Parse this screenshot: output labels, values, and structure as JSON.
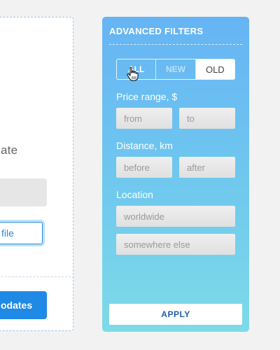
{
  "left_card": {
    "partial_text": "ate",
    "file_button_label": "file",
    "updates_button_label": "odates"
  },
  "filters": {
    "title": "ADVANCED FILTERS",
    "segments": [
      {
        "label": "ALL",
        "selected": false
      },
      {
        "label": "NEW",
        "selected": false
      },
      {
        "label": "OLD",
        "selected": true
      }
    ],
    "price_label": "Price range, $",
    "price_from_placeholder": "from",
    "price_to_placeholder": "to",
    "distance_label": "Distance, km",
    "distance_before_placeholder": "before",
    "distance_after_placeholder": "after",
    "location_label": "Location",
    "location_primary_placeholder": "worldwide",
    "location_secondary_placeholder": "somewhere else",
    "apply_label": "APPLY"
  },
  "cursor_icon": "hand-pointer-icon"
}
